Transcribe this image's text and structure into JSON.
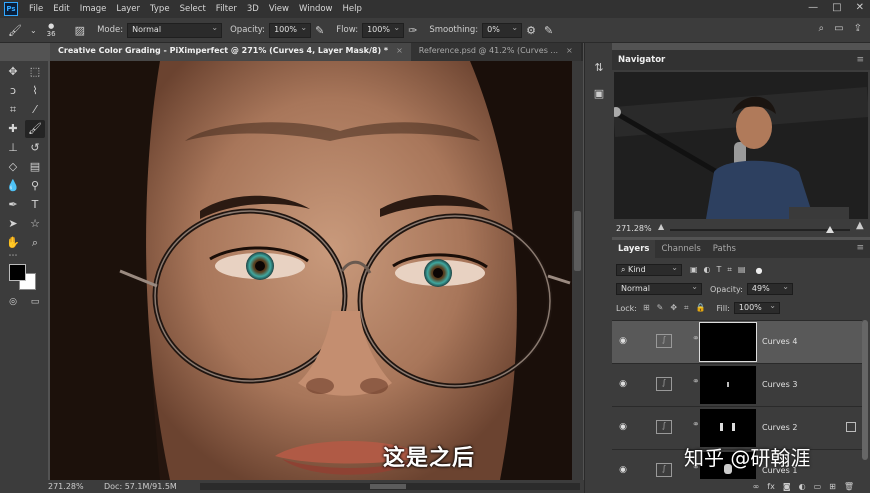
{
  "menubar": {
    "logo": "Ps",
    "items": [
      "File",
      "Edit",
      "Image",
      "Layer",
      "Type",
      "Select",
      "Filter",
      "3D",
      "View",
      "Window",
      "Help"
    ],
    "window_controls": [
      "—",
      "□",
      "✕"
    ]
  },
  "options": {
    "brush_size": "36",
    "mode_label": "Mode:",
    "mode_value": "Normal",
    "opacity_label": "Opacity:",
    "opacity_value": "100%",
    "flow_label": "Flow:",
    "flow_value": "100%",
    "smoothing_label": "Smoothing:",
    "smoothing_value": "0%"
  },
  "tabs": [
    {
      "label": "Creative Color Grading - PiXimperfect @ 271% (Curves 4, Layer Mask/8) *",
      "close": "×"
    },
    {
      "label": "Reference.psd @ 41.2% (Curves ...",
      "close": "×"
    }
  ],
  "canvas": {
    "caption": "这是之后"
  },
  "status": {
    "zoom": "271.28%",
    "doc": "Doc: 57.1M/91.5M"
  },
  "navigator": {
    "title": "Navigator",
    "zoom": "271.28%"
  },
  "layers": {
    "tabs": [
      "Layers",
      "Channels",
      "Paths"
    ],
    "filter_kind": "Kind",
    "blend_mode": "Normal",
    "opacity_label": "Opacity:",
    "opacity_value": "49%",
    "lock_label": "Lock:",
    "fill_label": "Fill:",
    "fill_value": "100%",
    "items": [
      {
        "name": "Curves 4",
        "selected": true
      },
      {
        "name": "Curves 3",
        "selected": false
      },
      {
        "name": "Curves 2",
        "selected": false
      },
      {
        "name": "Curves 1",
        "selected": false
      }
    ],
    "footer_icons": [
      "∞",
      "fx",
      "◙",
      "◐",
      "▭",
      "⊞",
      "🗑"
    ]
  },
  "watermark": "知乎 @研翰涯"
}
